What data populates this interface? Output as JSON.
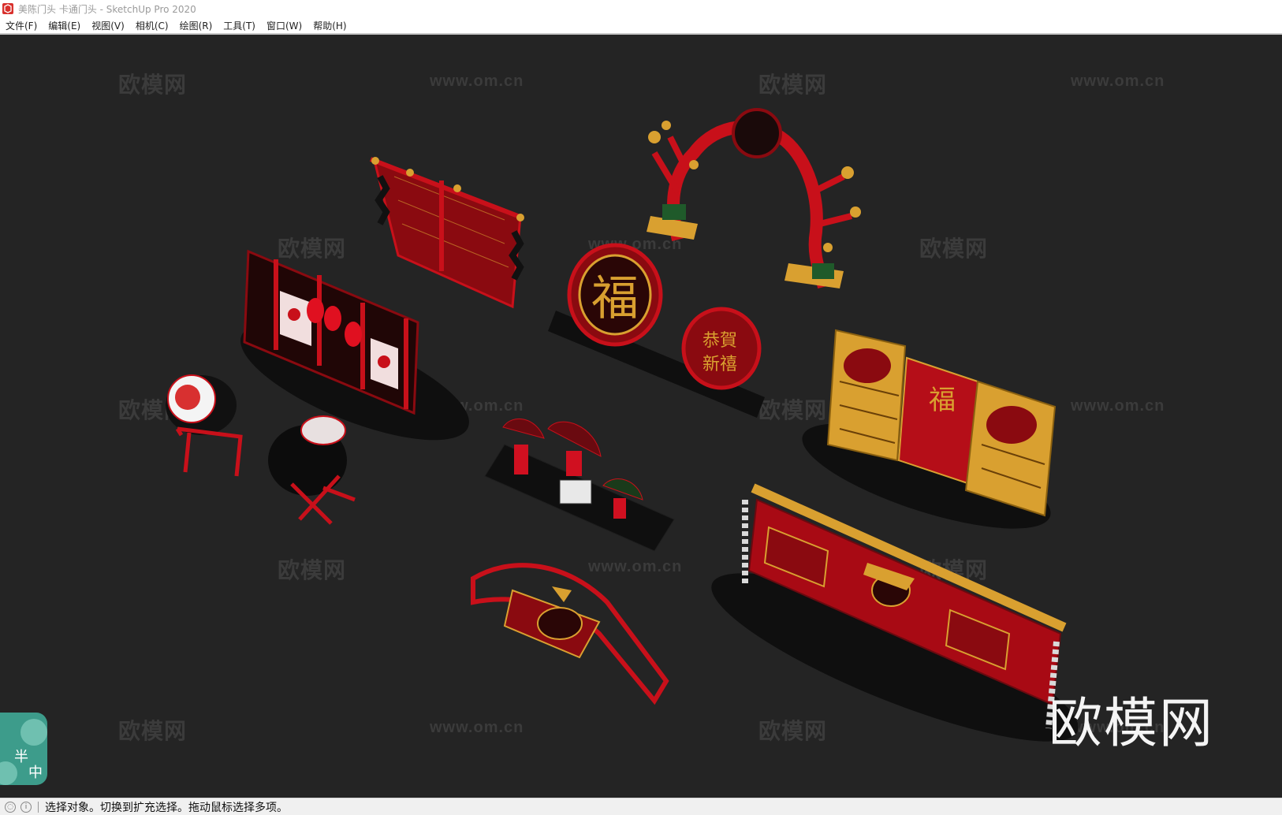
{
  "window": {
    "title": "美陈门头 卡通门头 - SketchUp Pro 2020",
    "icon": "sketchup-logo-icon"
  },
  "menu": [
    {
      "label": "文件(F)"
    },
    {
      "label": "编辑(E)"
    },
    {
      "label": "视图(V)"
    },
    {
      "label": "相机(C)"
    },
    {
      "label": "绘图(R)"
    },
    {
      "label": "工具(T)"
    },
    {
      "label": "窗口(W)"
    },
    {
      "label": "帮助(H)"
    }
  ],
  "watermark": {
    "logo_text": "欧模网",
    "url_text": "www.om.cn",
    "big_text": "欧模网"
  },
  "badge": {
    "char1": "半",
    "char2": "中"
  },
  "model_text": {
    "fu": "福",
    "gongxi": "恭賀",
    "xinxi": "新禧",
    "fu_panel": "福"
  },
  "colors": {
    "background": "#242424",
    "accent_red": "#c8101a",
    "gold": "#d9a030",
    "base_black": "#0f0f0f"
  },
  "status": {
    "text": "选择对象。切换到扩充选择。拖动鼠标选择多项。",
    "icon1": "geo-location-icon",
    "icon2": "info-icon"
  }
}
